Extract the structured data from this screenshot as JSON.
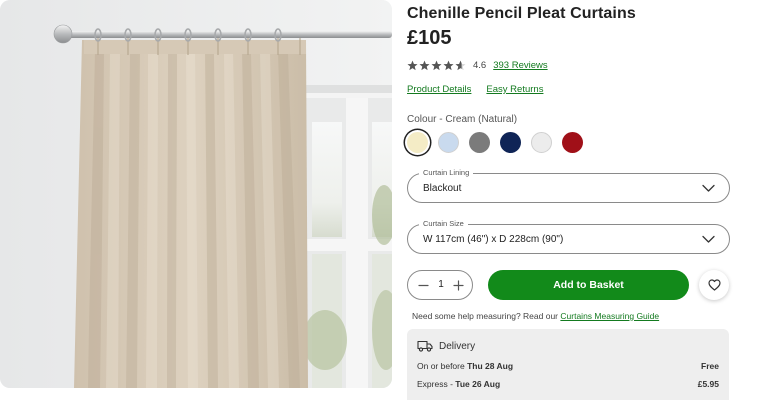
{
  "product": {
    "title": "Chenille Pencil Pleat Curtains",
    "price": "£105",
    "rating": "4.6",
    "rating_fraction": 0.92,
    "reviews_label": "393 Reviews"
  },
  "links": {
    "product_details": "Product Details",
    "easy_returns": "Easy Returns"
  },
  "colour": {
    "label": "Colour - Cream (Natural)",
    "swatches": [
      {
        "color": "#f4ecc6",
        "selected": true
      },
      {
        "color": "#c9daee",
        "selected": false
      },
      {
        "color": "#7b7b7b",
        "selected": false
      },
      {
        "color": "#0f2456",
        "selected": false
      },
      {
        "color": "#ececec",
        "selected": false
      },
      {
        "color": "#a01018",
        "selected": false
      }
    ]
  },
  "lining": {
    "legend": "Curtain Lining",
    "value": "Blackout"
  },
  "size": {
    "legend": "Curtain Size",
    "value": "W 117cm (46\") x D 228cm (90\")"
  },
  "quantity": {
    "value": "1"
  },
  "actions": {
    "add_to_basket": "Add to Basket"
  },
  "help": {
    "text": "Need some help measuring? Read our",
    "link": "Curtains Measuring Guide"
  },
  "delivery": {
    "title": "Delivery",
    "rows": [
      {
        "prefix": "On or before",
        "date": "Thu 28 Aug",
        "price": "Free"
      },
      {
        "prefix": "Express -",
        "date": "Tue 26 Aug",
        "price": "£5.95"
      }
    ]
  },
  "colors": {
    "accent_green": "#128a1a",
    "link_green": "#137a1f",
    "curtain": "#d8cbb8"
  },
  "icons": {
    "star": "star-icon",
    "chevron": "chevron-down-icon",
    "minus": "minus-icon",
    "plus": "plus-icon",
    "heart": "heart-icon",
    "truck": "truck-icon"
  }
}
